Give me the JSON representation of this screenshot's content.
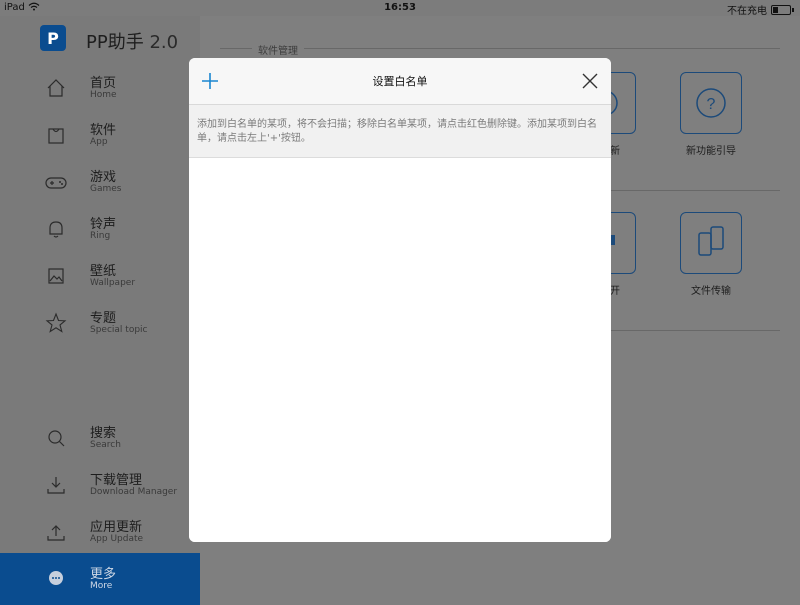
{
  "statusbar": {
    "device": "iPad",
    "time": "16:53",
    "charging": "不在充电"
  },
  "sidebar": {
    "app_title": "PP助手",
    "version": "2.0",
    "items": [
      {
        "zh": "首页",
        "en": "Home",
        "icon": "home-icon"
      },
      {
        "zh": "软件",
        "en": "App",
        "icon": "bag-icon"
      },
      {
        "zh": "游戏",
        "en": "Games",
        "icon": "gamepad-icon"
      },
      {
        "zh": "铃声",
        "en": "Ring",
        "icon": "bell-icon"
      },
      {
        "zh": "壁纸",
        "en": "Wallpaper",
        "icon": "image-icon"
      },
      {
        "zh": "专题",
        "en": "Special topic",
        "icon": "star-icon"
      },
      {
        "zh": "搜索",
        "en": "Search",
        "icon": "search-icon"
      },
      {
        "zh": "下载管理",
        "en": "Download Manager",
        "icon": "download-icon"
      },
      {
        "zh": "应用更新",
        "en": "App Update",
        "icon": "update-icon"
      },
      {
        "zh": "更多",
        "en": "More",
        "icon": "more-icon",
        "active": true
      }
    ]
  },
  "content": {
    "section_label": "软件管理",
    "tiles": [
      {
        "label": "新",
        "icon": "refresh-icon"
      },
      {
        "label": "新功能引导",
        "icon": "question-icon"
      },
      {
        "label": "开",
        "icon": "grid-icon"
      },
      {
        "label": "文件传输",
        "icon": "devices-icon"
      }
    ]
  },
  "modal": {
    "title": "设置白名单",
    "description": "添加到白名单的某项，将不会扫描；移除白名单某项，请点击红色删除键。添加某项到白名单，请点击左上'+'按钮。"
  },
  "colors": {
    "accent": "#0a4c8f",
    "icon_blue": "#1a86d0"
  }
}
